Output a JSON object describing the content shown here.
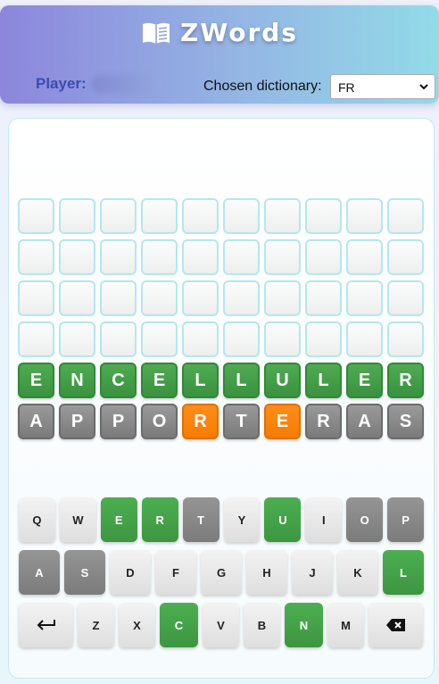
{
  "header": {
    "title": "ZWords",
    "title_icon": "book-icon",
    "player_label": "Player:",
    "player_name": "redacted",
    "dictionary_label": "Chosen dictionary:",
    "dictionary_value": "FR"
  },
  "colors": {
    "green": "#43a047",
    "gray": "#888888",
    "orange": "#f57c00",
    "empty_border": "#b4e7ee",
    "player_text": "#3a4cb0"
  },
  "board": {
    "rows": [
      {
        "letters": [
          "",
          "",
          "",
          "",
          "",
          "",
          "",
          "",
          "",
          ""
        ],
        "states": [
          "empty",
          "empty",
          "empty",
          "empty",
          "empty",
          "empty",
          "empty",
          "empty",
          "empty",
          "empty"
        ]
      },
      {
        "letters": [
          "",
          "",
          "",
          "",
          "",
          "",
          "",
          "",
          "",
          ""
        ],
        "states": [
          "empty",
          "empty",
          "empty",
          "empty",
          "empty",
          "empty",
          "empty",
          "empty",
          "empty",
          "empty"
        ]
      },
      {
        "letters": [
          "",
          "",
          "",
          "",
          "",
          "",
          "",
          "",
          "",
          ""
        ],
        "states": [
          "empty",
          "empty",
          "empty",
          "empty",
          "empty",
          "empty",
          "empty",
          "empty",
          "empty",
          "empty"
        ]
      },
      {
        "letters": [
          "",
          "",
          "",
          "",
          "",
          "",
          "",
          "",
          "",
          ""
        ],
        "states": [
          "empty",
          "empty",
          "empty",
          "empty",
          "empty",
          "empty",
          "empty",
          "empty",
          "empty",
          "empty"
        ]
      },
      {
        "letters": [
          "E",
          "N",
          "C",
          "E",
          "L",
          "L",
          "U",
          "L",
          "E",
          "R"
        ],
        "states": [
          "green",
          "green",
          "green",
          "green",
          "green",
          "green",
          "green",
          "green",
          "green",
          "green"
        ]
      },
      {
        "letters": [
          "A",
          "P",
          "P",
          "O",
          "R",
          "T",
          "E",
          "R",
          "A",
          "S"
        ],
        "states": [
          "gray",
          "gray",
          "gray",
          "gray",
          "orange",
          "gray",
          "orange",
          "gray",
          "gray",
          "gray"
        ]
      }
    ]
  },
  "keyboard": {
    "rows": [
      [
        {
          "label": "Q",
          "state": "default"
        },
        {
          "label": "W",
          "state": "default"
        },
        {
          "label": "E",
          "state": "green"
        },
        {
          "label": "R",
          "state": "green"
        },
        {
          "label": "T",
          "state": "gray"
        },
        {
          "label": "Y",
          "state": "default"
        },
        {
          "label": "U",
          "state": "green"
        },
        {
          "label": "I",
          "state": "default"
        },
        {
          "label": "O",
          "state": "gray"
        },
        {
          "label": "P",
          "state": "gray"
        }
      ],
      [
        {
          "label": "A",
          "state": "gray"
        },
        {
          "label": "S",
          "state": "gray"
        },
        {
          "label": "D",
          "state": "default"
        },
        {
          "label": "F",
          "state": "default"
        },
        {
          "label": "G",
          "state": "default"
        },
        {
          "label": "H",
          "state": "default"
        },
        {
          "label": "J",
          "state": "default"
        },
        {
          "label": "K",
          "state": "default"
        },
        {
          "label": "L",
          "state": "green"
        }
      ],
      [
        {
          "label": "",
          "state": "default",
          "icon": "enter-icon"
        },
        {
          "label": "Z",
          "state": "default"
        },
        {
          "label": "X",
          "state": "default"
        },
        {
          "label": "C",
          "state": "green"
        },
        {
          "label": "V",
          "state": "default"
        },
        {
          "label": "B",
          "state": "default"
        },
        {
          "label": "N",
          "state": "green"
        },
        {
          "label": "M",
          "state": "default"
        },
        {
          "label": "",
          "state": "default",
          "icon": "backspace-icon"
        }
      ]
    ]
  }
}
